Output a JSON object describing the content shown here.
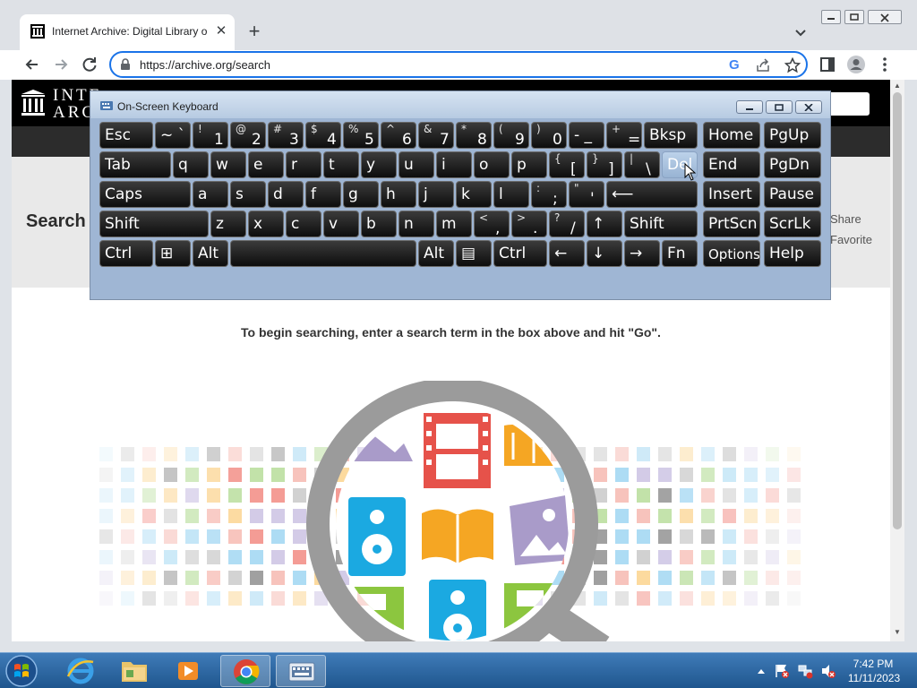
{
  "browser": {
    "tab_title": "Internet Archive: Digital Library o",
    "url": "https://archive.org/search",
    "new_tab_symbol": "+",
    "tab_close_symbol": "✕",
    "google_icon": "G"
  },
  "page": {
    "logo_line1": "INTE",
    "logo_line2": "ARCH",
    "search_heading": "Search",
    "share_label": "Share",
    "favorite_label": "Favorite",
    "instruction": "To begin searching, enter a search term in the box above and hit \"Go\"."
  },
  "osk": {
    "title": "On-Screen Keyboard",
    "rows": [
      [
        {
          "main": "Esc"
        },
        {
          "main": "~ `"
        },
        {
          "shift": "!",
          "main": "1"
        },
        {
          "shift": "@",
          "main": "2"
        },
        {
          "shift": "#",
          "main": "3"
        },
        {
          "shift": "$",
          "main": "4"
        },
        {
          "shift": "%",
          "main": "5"
        },
        {
          "shift": "^",
          "main": "6"
        },
        {
          "shift": "&",
          "main": "7"
        },
        {
          "shift": "*",
          "main": "8"
        },
        {
          "shift": "(",
          "main": "9"
        },
        {
          "shift": ")",
          "main": "0"
        },
        {
          "main": "- _"
        },
        {
          "shift": "+",
          "main": "="
        },
        {
          "main": "Bksp"
        },
        {
          "main": "Home"
        },
        {
          "main": "PgUp"
        }
      ],
      [
        {
          "main": "Tab"
        },
        {
          "main": "q"
        },
        {
          "main": "w"
        },
        {
          "main": "e"
        },
        {
          "main": "r"
        },
        {
          "main": "t"
        },
        {
          "main": "y"
        },
        {
          "main": "u"
        },
        {
          "main": "i"
        },
        {
          "main": "o"
        },
        {
          "main": "p"
        },
        {
          "shift": "{",
          "main": "["
        },
        {
          "shift": "}",
          "main": "]"
        },
        {
          "shift": "|",
          "main": "\\"
        },
        {
          "main": "Del"
        },
        {
          "main": "End"
        },
        {
          "main": "PgDn"
        }
      ],
      [
        {
          "main": "Caps"
        },
        {
          "main": "a"
        },
        {
          "main": "s"
        },
        {
          "main": "d"
        },
        {
          "main": "f"
        },
        {
          "main": "g"
        },
        {
          "main": "h"
        },
        {
          "main": "j"
        },
        {
          "main": "k"
        },
        {
          "main": "l"
        },
        {
          "shift": ":",
          "main": ";"
        },
        {
          "shift": "\"",
          "main": "'"
        },
        {
          "main": "⟵"
        },
        {
          "main": "Insert"
        },
        {
          "main": "Pause"
        }
      ],
      [
        {
          "main": "Shift"
        },
        {
          "main": "z"
        },
        {
          "main": "x"
        },
        {
          "main": "c"
        },
        {
          "main": "v"
        },
        {
          "main": "b"
        },
        {
          "main": "n"
        },
        {
          "main": "m"
        },
        {
          "shift": "<",
          "main": ","
        },
        {
          "shift": ">",
          "main": "."
        },
        {
          "shift": "?",
          "main": "/"
        },
        {
          "main": "↑"
        },
        {
          "main": "Shift"
        },
        {
          "main": "PrtScn"
        },
        {
          "main": "ScrLk"
        }
      ],
      [
        {
          "main": "Ctrl"
        },
        {
          "main": "⊞"
        },
        {
          "main": "Alt"
        },
        {
          "main": ""
        },
        {
          "main": "Alt"
        },
        {
          "main": "▤"
        },
        {
          "main": "Ctrl"
        },
        {
          "main": "←"
        },
        {
          "main": "↓"
        },
        {
          "main": "→"
        },
        {
          "main": "Fn"
        },
        {
          "main": "Options"
        },
        {
          "main": "Help"
        }
      ]
    ],
    "pressed_key": "Del"
  },
  "taskbar": {
    "time": "7:42 PM",
    "date": "11/11/2023",
    "apps": [
      "internet-explorer",
      "file-explorer",
      "media-player",
      "chrome",
      "on-screen-keyboard"
    ]
  },
  "colors": {
    "accent": "#1a73e8",
    "ia_header": "#000000",
    "osk_frame": "#a7bcd6",
    "taskbar": "#2a66a6"
  }
}
